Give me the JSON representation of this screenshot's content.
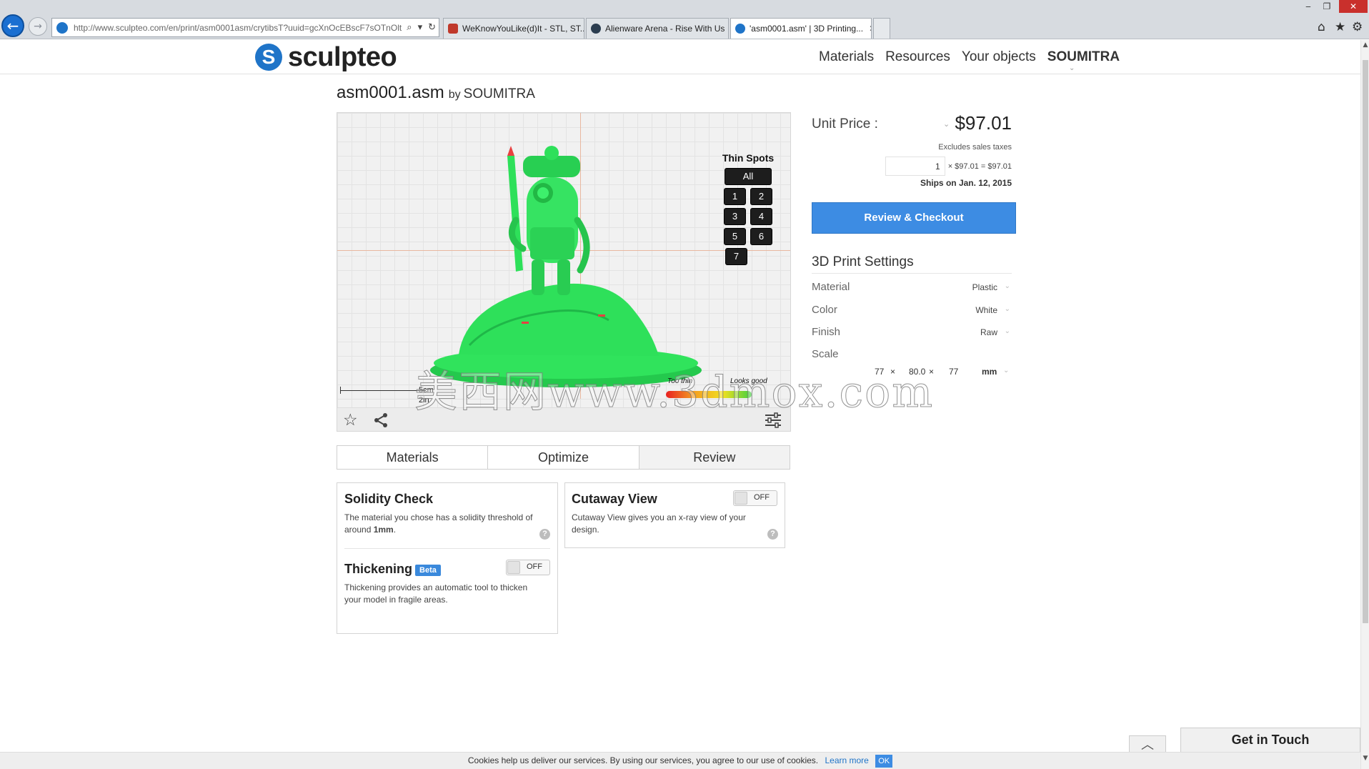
{
  "browser": {
    "url": "http://www.sculpteo.com/en/print/asm0001asm/crytibsT?uuid=gcXnOcEBscF7sOTnOlt",
    "tabs": [
      {
        "label": "WeKnowYouLike(d)It - STL, ST...",
        "favicon_color": "#c0392b",
        "active": false
      },
      {
        "label": "Alienware Arena - Rise With Us",
        "favicon_color": "#2c3e50",
        "active": false
      },
      {
        "label": "'asm0001.asm' | 3D Printing...",
        "favicon_color": "#1f74c8",
        "active": true
      }
    ],
    "back_glyph": "←",
    "forward_glyph": "→",
    "search_glyph": "⌕",
    "dropdown_glyph": "▾",
    "refresh_glyph": "↻",
    "close_glyph": "✕",
    "minimize_glyph": "‒",
    "restore_glyph": "❐",
    "home_glyph": "⌂",
    "star_glyph": "★",
    "gear_glyph": "⚙"
  },
  "header": {
    "logo_mark": "S",
    "logo_text": "sculpteo",
    "nav": [
      "Materials",
      "Resources",
      "Your objects"
    ],
    "user": "SOUMITRA",
    "user_caret": "⌄"
  },
  "product": {
    "filename": "asm0001.asm",
    "by": "by",
    "author": "SOUMITRA"
  },
  "viewer": {
    "thin_spots_title": "Thin Spots",
    "all_label": "All",
    "spots": [
      "1",
      "2",
      "3",
      "4",
      "5",
      "6",
      "7"
    ],
    "scale_cm": "5cm",
    "scale_in": "2in",
    "legend_thin": "Too thin",
    "legend_good": "Looks good",
    "favorite_icon": "☆",
    "share_icon": "share-icon",
    "settings_icon": "sliders-icon",
    "model_color": "#2ee05a",
    "watermark": "美西网www.3dmox.com"
  },
  "steps": [
    {
      "label": "Materials",
      "active": false
    },
    {
      "label": "Optimize",
      "active": false
    },
    {
      "label": "Review",
      "active": true
    }
  ],
  "solidity": {
    "title": "Solidity Check",
    "text_before": "The material you chose has a solidity threshold of around ",
    "threshold": "1mm",
    "text_after": ".",
    "help": "?"
  },
  "thickening": {
    "title": "Thickening",
    "badge": "Beta",
    "toggle": "OFF",
    "text": "Thickening provides an automatic tool to thicken your model in fragile areas."
  },
  "cutaway": {
    "title": "Cutaway View",
    "toggle": "OFF",
    "text": "Cutaway View gives you an x-ray view of your design.",
    "help": "?"
  },
  "pricing": {
    "unit_label": "Unit Price :",
    "unit_price": "$97.01",
    "excludes": "Excludes sales taxes",
    "quantity": "1",
    "calc": "× $97.01 = $97.01",
    "ships": "Ships on Jan. 12, 2015",
    "checkout_label": "Review & Checkout",
    "caret": "⌄"
  },
  "settings": {
    "title": "3D Print Settings",
    "rows": [
      {
        "key": "Material",
        "value": "Plastic"
      },
      {
        "key": "Color",
        "value": "White"
      },
      {
        "key": "Finish",
        "value": "Raw"
      },
      {
        "key": "Scale",
        "value": ""
      }
    ],
    "dims": {
      "x": "77",
      "y": "80.0",
      "z": "77",
      "times": "×",
      "unit": "mm"
    }
  },
  "cookie": {
    "text": "Cookies help us deliver our services. By using our services, you agree to our use of cookies.",
    "learn_more": "Learn more",
    "ok": "OK"
  },
  "footer": {
    "get_in_touch": "Get in Touch",
    "up_glyph": "︿"
  }
}
